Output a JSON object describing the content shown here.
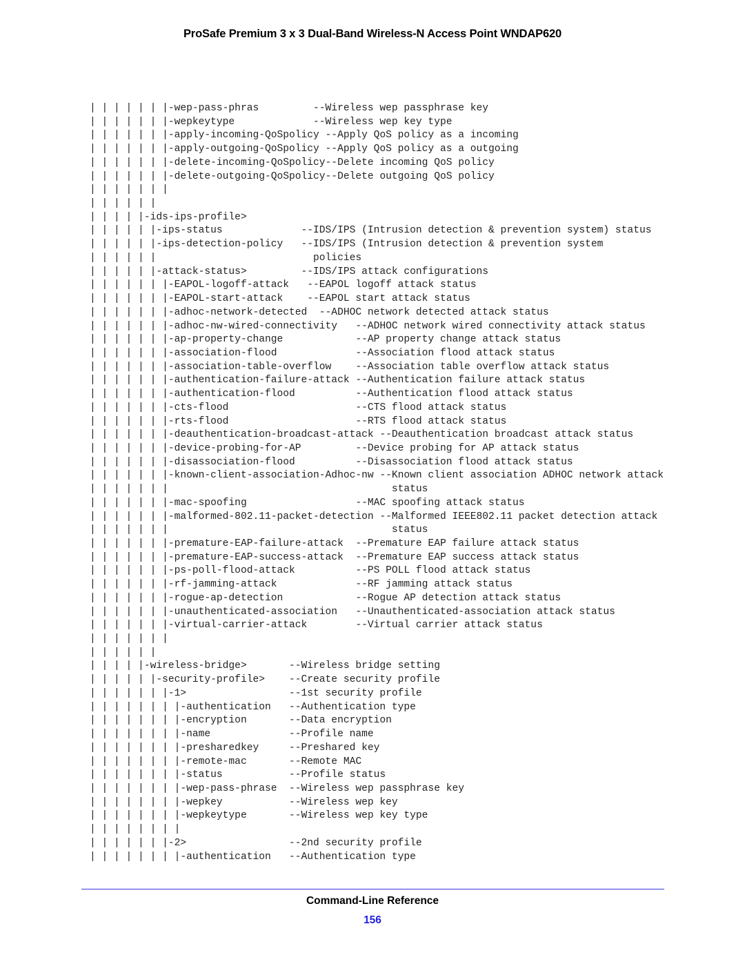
{
  "header": {
    "title": "ProSafe Premium 3 x 3 Dual-Band Wireless-N Access Point WNDAP620"
  },
  "footer": {
    "section_title": "Command-Line Reference",
    "page_number": "156",
    "rule_color": "#3b35e0",
    "page_number_color": "#1f1fe0"
  },
  "cli_tree": {
    "description": "Command-line hierarchy tree listing of WNDAP620 configuration commands",
    "pipe_char": "|",
    "dash_prefix": "-",
    "desc_prefix": "--",
    "lines": [
      "| | | | | | |-wep-pass-phras         --Wireless wep passphrase key",
      "| | | | | | |-wepkeytype             --Wireless wep key type",
      "| | | | | | |-apply-incoming-QoSpolicy --Apply QoS policy as a incoming",
      "| | | | | | |-apply-outgoing-QoSpolicy --Apply QoS policy as a outgoing",
      "| | | | | | |-delete-incoming-QoSpolicy--Delete incoming QoS policy",
      "| | | | | | |-delete-outgoing-QoSpolicy--Delete outgoing QoS policy",
      "| | | | | | |",
      "| | | | | |",
      "| | | | |-ids-ips-profile>",
      "| | | | | |-ips-status             --IDS/IPS (Intrusion detection & prevention system) status",
      "| | | | | |-ips-detection-policy   --IDS/IPS (Intrusion detection & prevention system",
      "| | | | | |                          policies",
      "| | | | | |-attack-status>         --IDS/IPS attack configurations",
      "| | | | | | |-EAPOL-logoff-attack   --EAPOL logoff attack status",
      "| | | | | | |-EAPOL-start-attack    --EAPOL start attack status",
      "| | | | | | |-adhoc-network-detected  --ADHOC network detected attack status",
      "| | | | | | |-adhoc-nw-wired-connectivity   --ADHOC network wired connectivity attack status",
      "| | | | | | |-ap-property-change            --AP property change attack status",
      "| | | | | | |-association-flood             --Association flood attack status",
      "| | | | | | |-association-table-overflow    --Association table overflow attack status",
      "| | | | | | |-authentication-failure-attack --Authentication failure attack status",
      "| | | | | | |-authentication-flood          --Authentication flood attack status",
      "| | | | | | |-cts-flood                     --CTS flood attack status",
      "| | | | | | |-rts-flood                     --RTS flood attack status",
      "| | | | | | |-deauthentication-broadcast-attack --Deauthentication broadcast attack status",
      "| | | | | | |-device-probing-for-AP         --Device probing for AP attack status",
      "| | | | | | |-disassociation-flood          --Disassociation flood attack status",
      "| | | | | | |-known-client-association-Adhoc-nw --Known client association ADHOC network attack",
      "| | | | | | |                                     status",
      "| | | | | | |-mac-spoofing                  --MAC spoofing attack status",
      "| | | | | | |-malformed-802.11-packet-detection --Malformed IEEE802.11 packet detection attack",
      "| | | | | | |                                     status",
      "| | | | | | |-premature-EAP-failure-attack  --Premature EAP failure attack status",
      "| | | | | | |-premature-EAP-success-attack  --Premature EAP success attack status",
      "| | | | | | |-ps-poll-flood-attack          --PS POLL flood attack status",
      "| | | | | | |-rf-jamming-attack             --RF jamming attack status",
      "| | | | | | |-rogue-ap-detection            --Rogue AP detection attack status",
      "| | | | | | |-unauthenticated-association   --Unauthenticated-association attack status",
      "| | | | | | |-virtual-carrier-attack        --Virtual carrier attack status",
      "| | | | | | |",
      "| | | | | |",
      "| | | | |-wireless-bridge>       --Wireless bridge setting",
      "| | | | | |-security-profile>    --Create security profile",
      "| | | | | | |-1>                 --1st security profile",
      "| | | | | | | |-authentication   --Authentication type",
      "| | | | | | | |-encryption       --Data encryption",
      "| | | | | | | |-name             --Profile name",
      "| | | | | | | |-presharedkey     --Preshared key",
      "| | | | | | | |-remote-mac       --Remote MAC",
      "| | | | | | | |-status           --Profile status",
      "| | | | | | | |-wep-pass-phrase  --Wireless wep passphrase key",
      "| | | | | | | |-wepkey           --Wireless wep key",
      "| | | | | | | |-wepkeytype       --Wireless wep key type",
      "| | | | | | | |",
      "| | | | | | |-2>                 --2nd security profile",
      "| | | | | | | |-authentication   --Authentication type"
    ]
  }
}
